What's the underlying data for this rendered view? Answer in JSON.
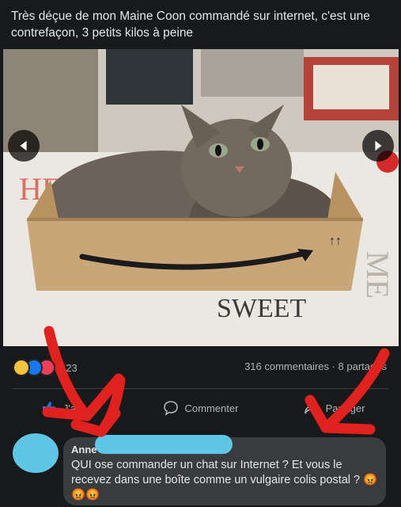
{
  "post": {
    "text": "Très déçue de mon Maine Coon commandé sur internet, c'est une contrefaçon, 3 petits kilos à peine"
  },
  "photo": {
    "box_text": "SWEET"
  },
  "stats": {
    "reaction_count": "423",
    "comments_shares": "316 commentaires · 8 partages"
  },
  "actions": {
    "like": "J'aime",
    "comment": "Commenter",
    "share": "Partager"
  },
  "comment": {
    "author": "Anne",
    "text": "QUI ose commander  un chat sur Internet ? Et vous le recevez dans une boîte comme un vulgaire colis postal ?",
    "emoji": "😡😡😡"
  },
  "colors": {
    "background": "#18191a",
    "accent": "#1877f2",
    "annotation_red": "#e0211d",
    "redaction_blue": "#5ec7e8"
  }
}
